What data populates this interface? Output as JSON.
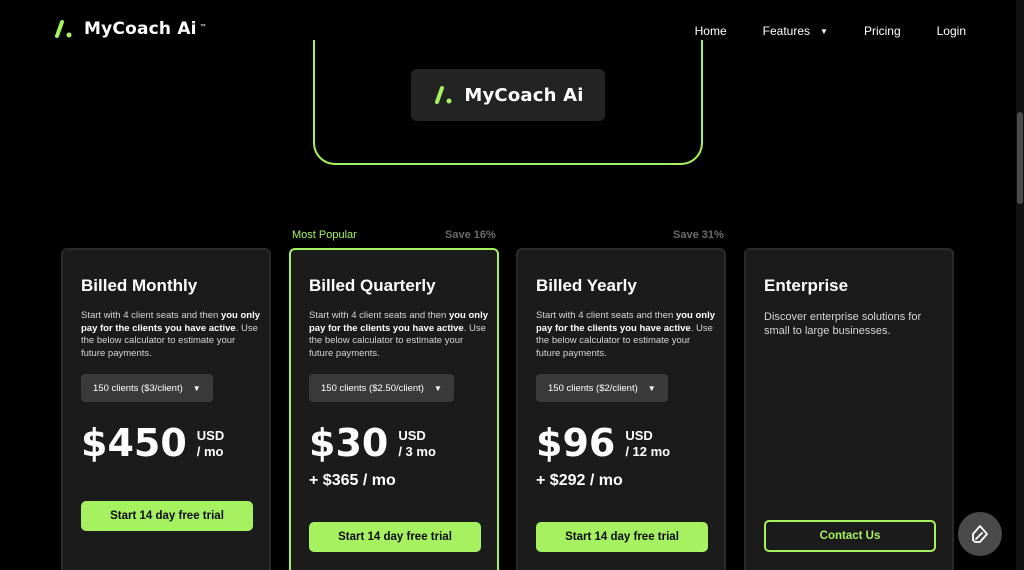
{
  "brand": {
    "name": "MyCoach Ai",
    "tm": "™",
    "accent": "#a6f15f"
  },
  "nav": {
    "items": [
      {
        "label": "Home"
      },
      {
        "label": "Features",
        "caret": "▼"
      },
      {
        "label": "Pricing"
      },
      {
        "label": "Login"
      }
    ]
  },
  "phone_preview": {
    "name": "MyCoach Ai"
  },
  "labels": {
    "most_popular": "Most Popular",
    "save_16": "Save 16%",
    "save_31": "Save 31%"
  },
  "plans": [
    {
      "title": "Billed Monthly",
      "desc_pre": "Start with 4 client seats and then ",
      "desc_bold1": "you only pay for the clients you have active",
      "desc_post": ". Use the below calculator to estimate your future payments.",
      "select": "150 clients ($3/client)",
      "price": "$450",
      "unit_line1": "USD",
      "unit_line2": "/ mo",
      "addon": "",
      "button": "Start 14 day free trial"
    },
    {
      "title": "Billed Quarterly",
      "desc_pre": "Start with 4 client seats and then ",
      "desc_bold1": "you only pay for the clients you have active",
      "desc_post": ". Use the below calculator to estimate your future payments.",
      "select": "150 clients ($2.50/client)",
      "price": "$30",
      "unit_line1": "USD",
      "unit_line2": "/ 3 mo",
      "addon": "+ $365 / mo",
      "button": "Start 14 day free trial"
    },
    {
      "title": "Billed Yearly",
      "desc_pre": "Start with 4 client seats and then ",
      "desc_bold1": "you only pay for the clients you have active",
      "desc_post": ". Use the below calculator to estimate your future payments.",
      "select": "150 clients ($2/client)",
      "price": "$96",
      "unit_line1": "USD",
      "unit_line2": "/ 12 mo",
      "addon": "+ $292 / mo",
      "button": "Start 14 day free trial"
    },
    {
      "title": "Enterprise",
      "desc": "Discover enterprise solutions for small to large businesses.",
      "button": "Contact Us"
    }
  ],
  "icons": {
    "logo": "logo-mark-icon",
    "chat": "chat-icon",
    "caret": "caret-down-icon"
  }
}
